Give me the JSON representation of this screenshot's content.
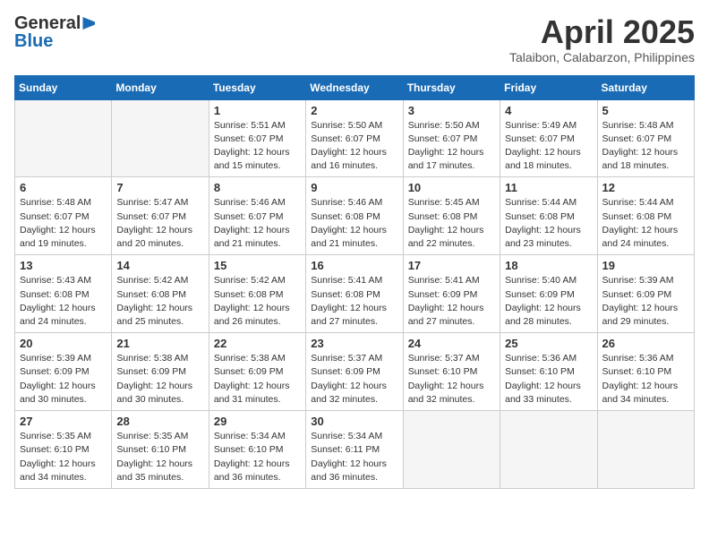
{
  "header": {
    "logo_general": "General",
    "logo_blue": "Blue",
    "month_title": "April 2025",
    "location": "Talaibon, Calabarzon, Philippines"
  },
  "calendar": {
    "days_of_week": [
      "Sunday",
      "Monday",
      "Tuesday",
      "Wednesday",
      "Thursday",
      "Friday",
      "Saturday"
    ],
    "weeks": [
      {
        "cells": [
          {
            "day": "",
            "empty": true,
            "content": ""
          },
          {
            "day": "",
            "empty": true,
            "content": ""
          },
          {
            "day": "1",
            "empty": false,
            "content": "Sunrise: 5:51 AM\nSunset: 6:07 PM\nDaylight: 12 hours\nand 15 minutes."
          },
          {
            "day": "2",
            "empty": false,
            "content": "Sunrise: 5:50 AM\nSunset: 6:07 PM\nDaylight: 12 hours\nand 16 minutes."
          },
          {
            "day": "3",
            "empty": false,
            "content": "Sunrise: 5:50 AM\nSunset: 6:07 PM\nDaylight: 12 hours\nand 17 minutes."
          },
          {
            "day": "4",
            "empty": false,
            "content": "Sunrise: 5:49 AM\nSunset: 6:07 PM\nDaylight: 12 hours\nand 18 minutes."
          },
          {
            "day": "5",
            "empty": false,
            "content": "Sunrise: 5:48 AM\nSunset: 6:07 PM\nDaylight: 12 hours\nand 18 minutes."
          }
        ]
      },
      {
        "cells": [
          {
            "day": "6",
            "empty": false,
            "content": "Sunrise: 5:48 AM\nSunset: 6:07 PM\nDaylight: 12 hours\nand 19 minutes."
          },
          {
            "day": "7",
            "empty": false,
            "content": "Sunrise: 5:47 AM\nSunset: 6:07 PM\nDaylight: 12 hours\nand 20 minutes."
          },
          {
            "day": "8",
            "empty": false,
            "content": "Sunrise: 5:46 AM\nSunset: 6:07 PM\nDaylight: 12 hours\nand 21 minutes."
          },
          {
            "day": "9",
            "empty": false,
            "content": "Sunrise: 5:46 AM\nSunset: 6:08 PM\nDaylight: 12 hours\nand 21 minutes."
          },
          {
            "day": "10",
            "empty": false,
            "content": "Sunrise: 5:45 AM\nSunset: 6:08 PM\nDaylight: 12 hours\nand 22 minutes."
          },
          {
            "day": "11",
            "empty": false,
            "content": "Sunrise: 5:44 AM\nSunset: 6:08 PM\nDaylight: 12 hours\nand 23 minutes."
          },
          {
            "day": "12",
            "empty": false,
            "content": "Sunrise: 5:44 AM\nSunset: 6:08 PM\nDaylight: 12 hours\nand 24 minutes."
          }
        ]
      },
      {
        "cells": [
          {
            "day": "13",
            "empty": false,
            "content": "Sunrise: 5:43 AM\nSunset: 6:08 PM\nDaylight: 12 hours\nand 24 minutes."
          },
          {
            "day": "14",
            "empty": false,
            "content": "Sunrise: 5:42 AM\nSunset: 6:08 PM\nDaylight: 12 hours\nand 25 minutes."
          },
          {
            "day": "15",
            "empty": false,
            "content": "Sunrise: 5:42 AM\nSunset: 6:08 PM\nDaylight: 12 hours\nand 26 minutes."
          },
          {
            "day": "16",
            "empty": false,
            "content": "Sunrise: 5:41 AM\nSunset: 6:08 PM\nDaylight: 12 hours\nand 27 minutes."
          },
          {
            "day": "17",
            "empty": false,
            "content": "Sunrise: 5:41 AM\nSunset: 6:09 PM\nDaylight: 12 hours\nand 27 minutes."
          },
          {
            "day": "18",
            "empty": false,
            "content": "Sunrise: 5:40 AM\nSunset: 6:09 PM\nDaylight: 12 hours\nand 28 minutes."
          },
          {
            "day": "19",
            "empty": false,
            "content": "Sunrise: 5:39 AM\nSunset: 6:09 PM\nDaylight: 12 hours\nand 29 minutes."
          }
        ]
      },
      {
        "cells": [
          {
            "day": "20",
            "empty": false,
            "content": "Sunrise: 5:39 AM\nSunset: 6:09 PM\nDaylight: 12 hours\nand 30 minutes."
          },
          {
            "day": "21",
            "empty": false,
            "content": "Sunrise: 5:38 AM\nSunset: 6:09 PM\nDaylight: 12 hours\nand 30 minutes."
          },
          {
            "day": "22",
            "empty": false,
            "content": "Sunrise: 5:38 AM\nSunset: 6:09 PM\nDaylight: 12 hours\nand 31 minutes."
          },
          {
            "day": "23",
            "empty": false,
            "content": "Sunrise: 5:37 AM\nSunset: 6:09 PM\nDaylight: 12 hours\nand 32 minutes."
          },
          {
            "day": "24",
            "empty": false,
            "content": "Sunrise: 5:37 AM\nSunset: 6:10 PM\nDaylight: 12 hours\nand 32 minutes."
          },
          {
            "day": "25",
            "empty": false,
            "content": "Sunrise: 5:36 AM\nSunset: 6:10 PM\nDaylight: 12 hours\nand 33 minutes."
          },
          {
            "day": "26",
            "empty": false,
            "content": "Sunrise: 5:36 AM\nSunset: 6:10 PM\nDaylight: 12 hours\nand 34 minutes."
          }
        ]
      },
      {
        "cells": [
          {
            "day": "27",
            "empty": false,
            "content": "Sunrise: 5:35 AM\nSunset: 6:10 PM\nDaylight: 12 hours\nand 34 minutes."
          },
          {
            "day": "28",
            "empty": false,
            "content": "Sunrise: 5:35 AM\nSunset: 6:10 PM\nDaylight: 12 hours\nand 35 minutes."
          },
          {
            "day": "29",
            "empty": false,
            "content": "Sunrise: 5:34 AM\nSunset: 6:10 PM\nDaylight: 12 hours\nand 36 minutes."
          },
          {
            "day": "30",
            "empty": false,
            "content": "Sunrise: 5:34 AM\nSunset: 6:11 PM\nDaylight: 12 hours\nand 36 minutes."
          },
          {
            "day": "",
            "empty": true,
            "content": ""
          },
          {
            "day": "",
            "empty": true,
            "content": ""
          },
          {
            "day": "",
            "empty": true,
            "content": ""
          }
        ]
      }
    ]
  }
}
